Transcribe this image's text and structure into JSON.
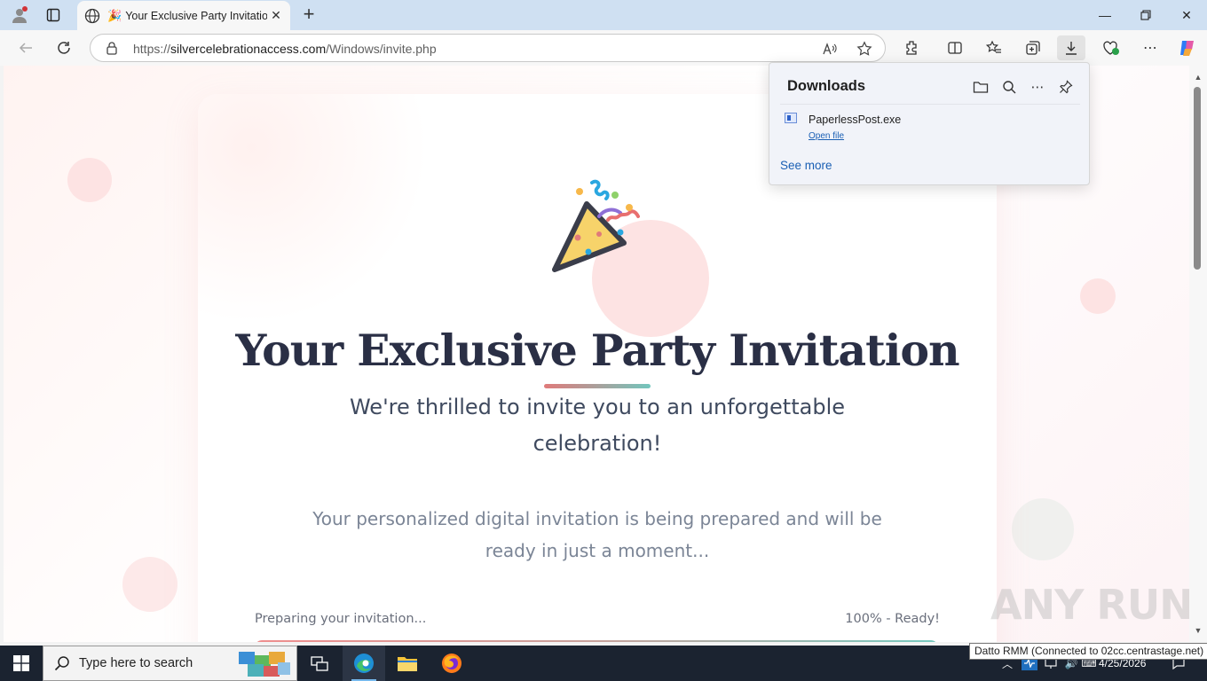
{
  "browser": {
    "tab": {
      "title": "Your Exclusive Party Invitation",
      "favicon": "🎉"
    },
    "url": {
      "base": "https://",
      "domain": "silvercelebrationaccess.com",
      "path": "/Windows/invite.php"
    }
  },
  "downloads": {
    "title": "Downloads",
    "items": [
      {
        "filename": "PaperlessPost.exe",
        "action": "Open file"
      }
    ],
    "see_more": "See more"
  },
  "page": {
    "headline": "Your Exclusive Party Invitation",
    "subtitle": "We're thrilled to invite you to an unforgettable celebration!",
    "description": "Your personalized digital invitation is being prepared and will be ready in just a moment...",
    "progress": {
      "label": "Preparing your invitation...",
      "status": "100% - Ready!",
      "percent": 100
    },
    "accent_colors": {
      "coral": "#e07a7a",
      "teal": "#72c6bd",
      "heading": "#2a2f45"
    }
  },
  "watermark": "ANY RUN",
  "tooltip": "Datto RMM (Connected to 02cc.centrastage.net)",
  "taskbar": {
    "search_placeholder": "Type here to search",
    "date": "4/25/2026"
  }
}
